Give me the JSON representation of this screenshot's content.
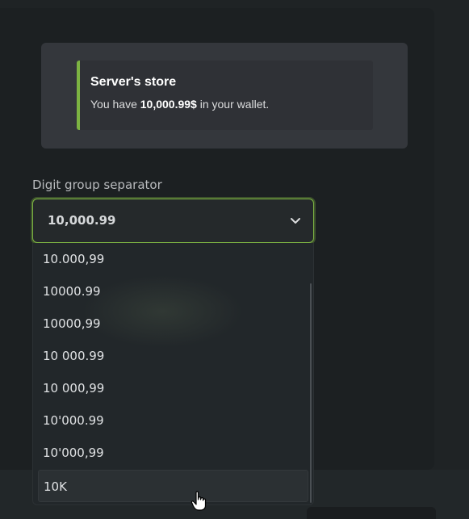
{
  "preview": {
    "title": "Server's store",
    "desc_before": "You have ",
    "amount": "10,000.99$",
    "desc_after": " in your wallet."
  },
  "field": {
    "label": "Digit group separator",
    "selected": "10,000.99",
    "icon": "chevron-down-icon"
  },
  "options": [
    "10.000,99",
    "10000.99",
    "10000,99",
    "10 000.99",
    "10 000,99",
    "10'000.99",
    "10'000,99",
    "10K"
  ],
  "hovered_option": "10K",
  "colors": {
    "accent": "#7cb342",
    "background": "#1f2325"
  }
}
